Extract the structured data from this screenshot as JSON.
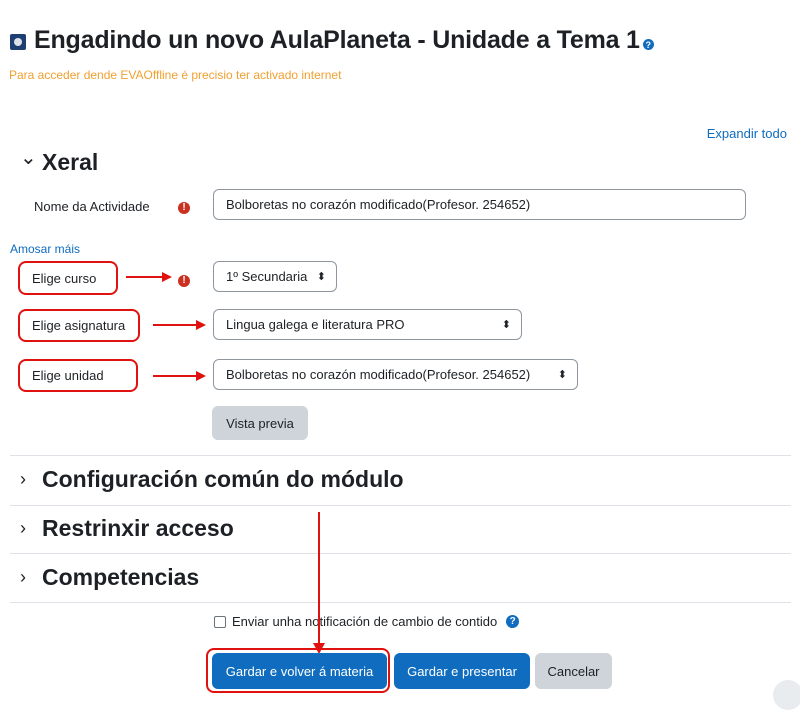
{
  "header": {
    "title": "Engadindo un novo AulaPlaneta - Unidade a Tema 1",
    "help_glyph": "?",
    "notice": "Para acceder dende EVAOffline é precisio ter activado internet"
  },
  "expand_all": "Expandir todo",
  "sections": {
    "general": {
      "title": "Xeral",
      "chevron": "⌄"
    },
    "common_module": {
      "title": "Configuración común do módulo",
      "chevron": "›"
    },
    "restrict": {
      "title": "Restrinxir acceso",
      "chevron": "›"
    },
    "competencies": {
      "title": "Competencias",
      "chevron": "›"
    }
  },
  "form": {
    "activity_name_label": "Nome da Actividade",
    "activity_name_value": "Bolboretas no corazón modificado(Profesor. 254652)",
    "show_more": "Amosar máis",
    "course_label": "Elige curso",
    "course_value": "1º Secundaria",
    "subject_label": "Elige asignatura",
    "subject_value": "Lingua galega e literatura PRO",
    "unit_label": "Elige unidad",
    "unit_value": "Bolboretas no corazón modificado(Profesor. 254652)",
    "preview_button": "Vista previa"
  },
  "footer": {
    "notify_label": "Enviar unha notificación de cambio de contido",
    "save_return": "Gardar e volver á materia",
    "save_display": "Gardar e presentar",
    "cancel": "Cancelar"
  },
  "colors": {
    "primary": "#0f6cbf",
    "annotation_red": "#e0120f",
    "error_red": "#ca3120",
    "notice_orange": "#f0a030"
  },
  "icons": {
    "title": "aulaplaneta-icon",
    "required": "exclamation-circle-icon",
    "help": "question-circle-icon"
  }
}
